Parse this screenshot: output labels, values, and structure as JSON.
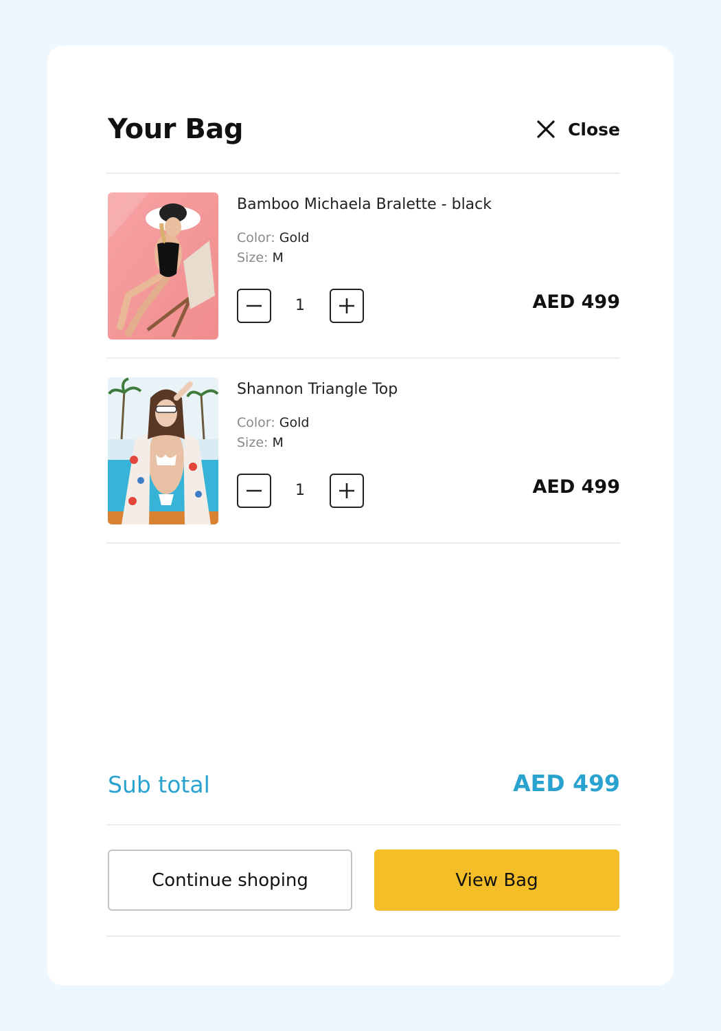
{
  "header": {
    "title": "Your Bag",
    "close_label": "Close"
  },
  "items": [
    {
      "name": "Bamboo Michaela Bralette - black",
      "color_label": "Color:",
      "color_value": "Gold",
      "size_label": "Size:",
      "size_value": "M",
      "quantity": "1",
      "price": "AED 499"
    },
    {
      "name": "Shannon Triangle Top",
      "color_label": "Color:",
      "color_value": "Gold",
      "size_label": "Size:",
      "size_value": "M",
      "quantity": "1",
      "price": "AED 499"
    }
  ],
  "summary": {
    "subtotal_label": "Sub total",
    "subtotal_value": "AED 499"
  },
  "actions": {
    "continue_label": "Continue shoping",
    "view_bag_label": "View Bag"
  },
  "colors": {
    "accent": "#2aa2cf",
    "primary_button": "#f3be27",
    "page_background": "#eef7fd"
  },
  "icons": {
    "close": "close-icon",
    "decrease": "minus-icon",
    "increase": "plus-icon"
  }
}
